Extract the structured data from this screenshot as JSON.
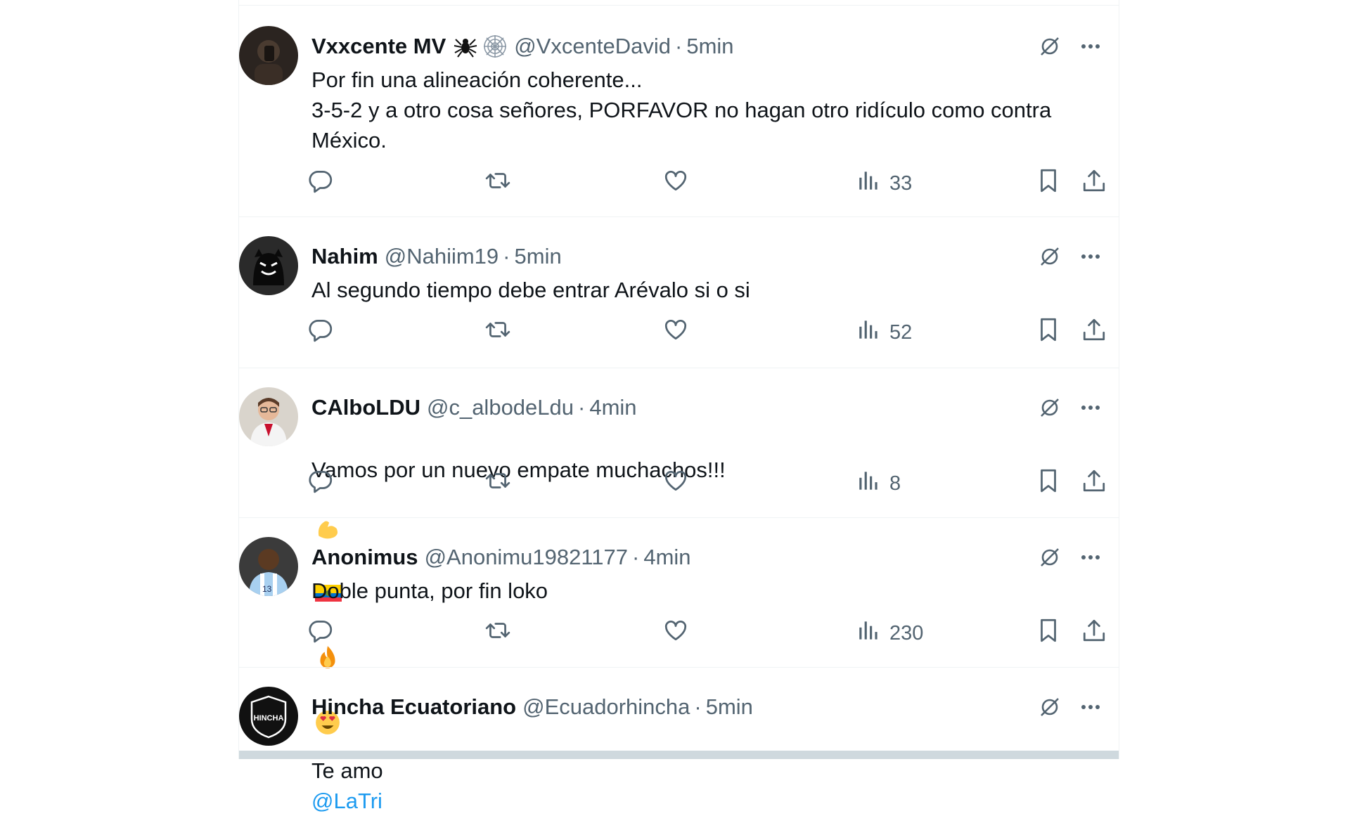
{
  "colors": {
    "text_primary": "#0f1419",
    "text_secondary": "#536471",
    "link": "#1d9bf0",
    "divider": "#eff3f4"
  },
  "tweets": [
    {
      "name": "Vxxcente MV",
      "badges": [
        "spider-icon",
        "spiderweb-icon"
      ],
      "handle": "@VxcenteDavid",
      "time": "5min",
      "text": "Por fin una alineación coherente...\n3-5-2 y a otro cosa señores, PORFAVOR no hagan otro ridículo como contra México.",
      "views": "33"
    },
    {
      "name": "Nahim",
      "handle": "@Nahiim19",
      "time": "5min",
      "text": "Al segundo tiempo debe entrar Arévalo si o si",
      "views": "52"
    },
    {
      "name": "CAlboLDU",
      "handle": "@c_albodeLdu",
      "time": "4min",
      "text": "Vamos por un nuevo empate muchachos!!!",
      "emojis": [
        "flexed-biceps-emoji",
        "ecuador-flag-emoji",
        "fire-emoji",
        "heart-eyes-emoji"
      ],
      "views": "8"
    },
    {
      "name": "Anonimus",
      "handle": "@Anonimu19821177",
      "time": "4min",
      "text": "Doble punta, por fin loko",
      "views": "230"
    },
    {
      "name": "Hincha Ecuatoriano",
      "handle": "@Ecuadorhincha",
      "time": "5min",
      "text": "Te amo",
      "mention": "@LaTri",
      "avatar_text": "HINCHA"
    }
  ],
  "separator": "·"
}
